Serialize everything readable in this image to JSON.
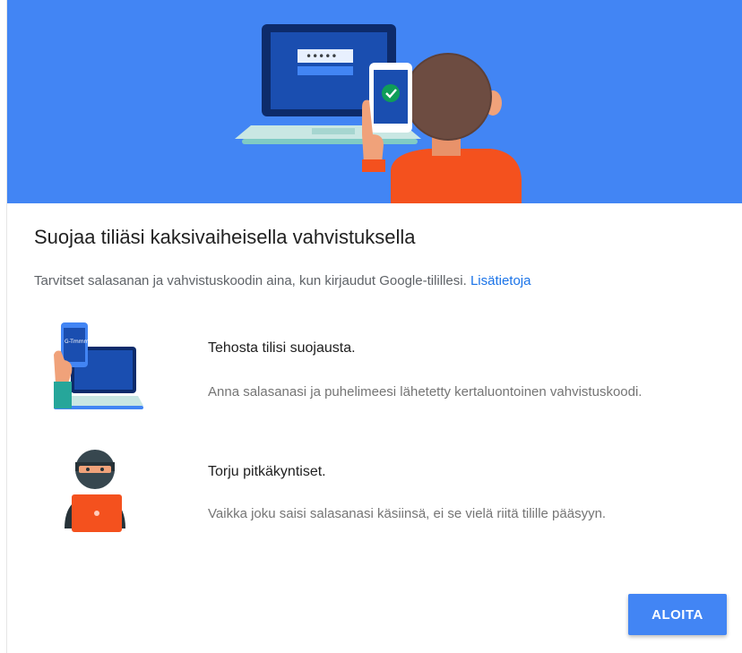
{
  "title": "Suojaa tiliäsi kaksivaiheisella vahvistuksella",
  "subtitle": {
    "text": "Tarvitset salasanan ja vahvistuskoodin aina, kun kirjaudut Google-tilillesi.",
    "link": "Lisätietoja"
  },
  "hero": {
    "password_mask": "•••••",
    "colors": {
      "background": "#4285f4",
      "laptop": "#1a4eb0",
      "skin": "#f0a27a",
      "shirt": "#f4511e"
    }
  },
  "features": [
    {
      "heading": "Tehosta tilisi suojausta.",
      "description": "Anna salasanasi ja puhelimeesi lähetetty kertaluontoinen vahvistuskoodi.",
      "icon": "phone-laptop-icon",
      "phone_text": "G-Tmmmn"
    },
    {
      "heading": "Torju pitkäkyntiset.",
      "description": "Vaikka joku saisi salasanasi käsiinsä, ei se vielä riitä tilille pääsyyn.",
      "icon": "hacker-icon"
    }
  ],
  "button": {
    "label": "ALOITA",
    "color": "#4285f4"
  }
}
